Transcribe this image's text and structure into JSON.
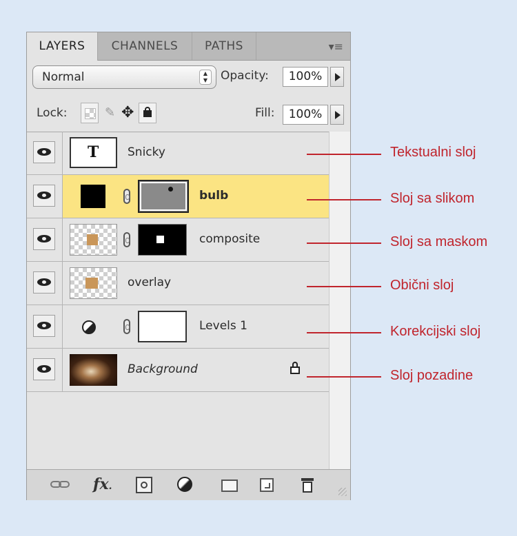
{
  "tabs": [
    "LAYERS",
    "CHANNELS",
    "PATHS"
  ],
  "panel_menu_icon": "menu-lines-icon",
  "blend_mode": "Normal",
  "opacity": {
    "label": "Opacity:",
    "value": "100%"
  },
  "lock": {
    "label": "Lock:"
  },
  "fill": {
    "label": "Fill:",
    "value": "100%"
  },
  "layers": [
    {
      "name": "Snicky",
      "type": "text",
      "thumb_letter": "T"
    },
    {
      "name": "bulb",
      "type": "image",
      "selected": true
    },
    {
      "name": "composite",
      "type": "masked"
    },
    {
      "name": "overlay",
      "type": "normal"
    },
    {
      "name": "Levels 1",
      "type": "adjustment"
    },
    {
      "name": "Background",
      "type": "background",
      "locked": true
    }
  ],
  "annotations": [
    "Tekstualni sloj",
    "Sloj sa slikom",
    "Sloj sa maskom",
    "Obični sloj",
    "Korekcijski sloj",
    "Sloj pozadine"
  ],
  "bottom_icons": [
    "link-layers-icon",
    "fx-icon",
    "add-mask-icon",
    "adjustment-layer-icon",
    "new-group-icon",
    "new-layer-icon",
    "trash-icon"
  ],
  "bottom_fx_label": "fx",
  "colors": {
    "annotation": "#c0242c",
    "selection": "#fbe483"
  }
}
